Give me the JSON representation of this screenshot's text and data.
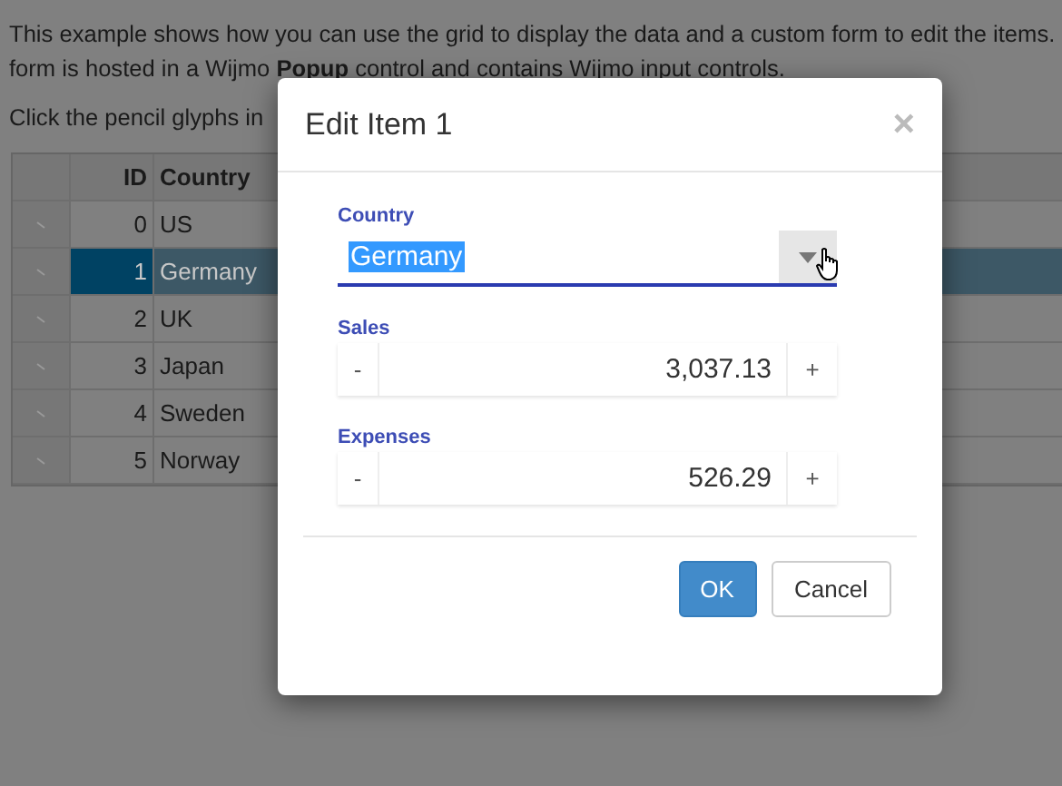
{
  "page": {
    "intro": "This example shows how you can use the grid to display the data and a custom form to edit the items.",
    "intro2": "form is hosted in a Wijmo **Popup** control and contains Wijmo input controls.",
    "instruction": "Click the pencil glyphs in"
  },
  "grid": {
    "columns": [
      "ID",
      "Country"
    ],
    "rows": [
      {
        "id": "0",
        "country": "US",
        "selected": false
      },
      {
        "id": "1",
        "country": "Germany",
        "selected": true
      },
      {
        "id": "2",
        "country": "UK",
        "selected": false
      },
      {
        "id": "3",
        "country": "Japan",
        "selected": false
      },
      {
        "id": "4",
        "country": "Sweden",
        "selected": false
      },
      {
        "id": "5",
        "country": "Norway",
        "selected": false
      }
    ]
  },
  "dialog": {
    "title": "Edit Item 1",
    "close": "×",
    "fields": [
      {
        "kind": "combo",
        "label": "Country",
        "value": "Germany",
        "text_selected": true
      },
      {
        "kind": "number",
        "label": "Sales",
        "value": "3,037.13",
        "decrement": "-",
        "increment": "+"
      },
      {
        "kind": "number",
        "label": "Expenses",
        "value": "526.29",
        "decrement": "-",
        "increment": "+"
      }
    ],
    "buttons": [
      {
        "label": "OK",
        "primary": true
      },
      {
        "label": "Cancel",
        "primary": false
      }
    ]
  }
}
